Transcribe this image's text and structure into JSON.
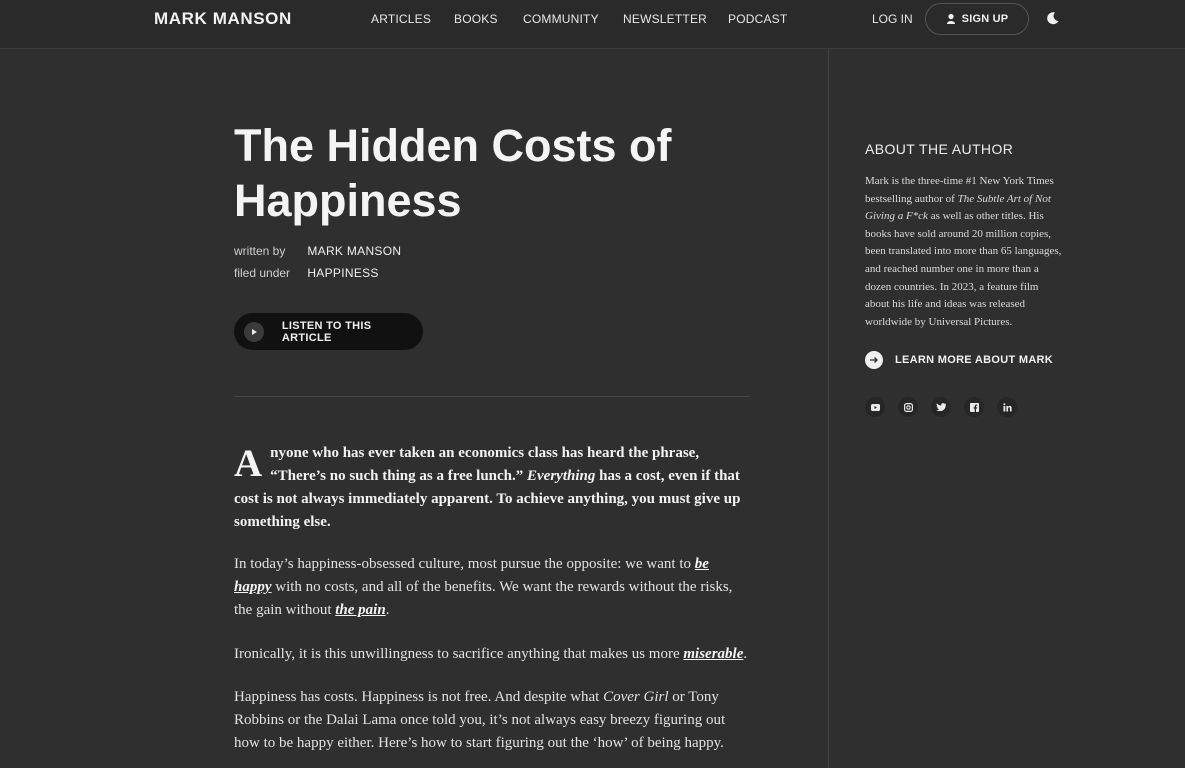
{
  "header": {
    "logo": "MARK MANSON",
    "nav": [
      "ARTICLES",
      "BOOKS",
      "COMMUNITY",
      "NEWSLETTER",
      "PODCAST"
    ],
    "login": "LOG IN",
    "signup": "SIGN UP",
    "theme_icon": "moon-icon"
  },
  "article": {
    "title": "The Hidden Costs of Happiness",
    "written_by_label": "written by",
    "author": "MARK MANSON",
    "filed_under_label": "filed under",
    "category": "HAPPINESS",
    "listen_label": "LISTEN TO THIS ARTICLE",
    "dropcap": "A",
    "p1": {
      "a": "nyone who has ever taken an economics class has heard the phrase, “There’s no such thing as a free lunch.” ",
      "em": "Everything",
      "b": " has a cost, even if that cost is not always immediately apparent. To achieve anything, you must give up something else."
    },
    "p2": {
      "a": "In today’s happiness-obsessed culture, most pursue the opposite: we want to ",
      "link1": "be happy",
      "b": " with no costs, and all of the benefits. We want the rewards without the risks, the gain without ",
      "link2": "the pain",
      "c": "."
    },
    "p3": {
      "a": "Ironically, it is this unwillingness to sacrifice anything that makes us more ",
      "link": "miserable",
      "b": "."
    },
    "p4": {
      "a": "Happiness has costs. Happiness is not free. And despite what ",
      "em": "Cover Girl",
      "b": " or Tony Robbins or the Dalai Lama once told you, it’s not always easy breezy figuring out how to be happy either. Here’s how to start figuring out the ‘how’ of being happy."
    }
  },
  "sidebar": {
    "title": "ABOUT THE AUTHOR",
    "bio_a": "Mark is the three-time #1 New York Times bestselling author of ",
    "bio_em": "The Subtle Art of Not Giving a F*ck",
    "bio_b": " as well as other titles. His books have sold around 20 million copies, been translated into more than 65 languages, and reached number one in more than a dozen countries. In 2023, a feature film about his life and ideas was released worldwide by Universal Pictures.",
    "learn_more": "LEARN MORE ABOUT MARK",
    "social": [
      "youtube-icon",
      "instagram-icon",
      "twitter-icon",
      "facebook-icon",
      "linkedin-icon"
    ]
  }
}
